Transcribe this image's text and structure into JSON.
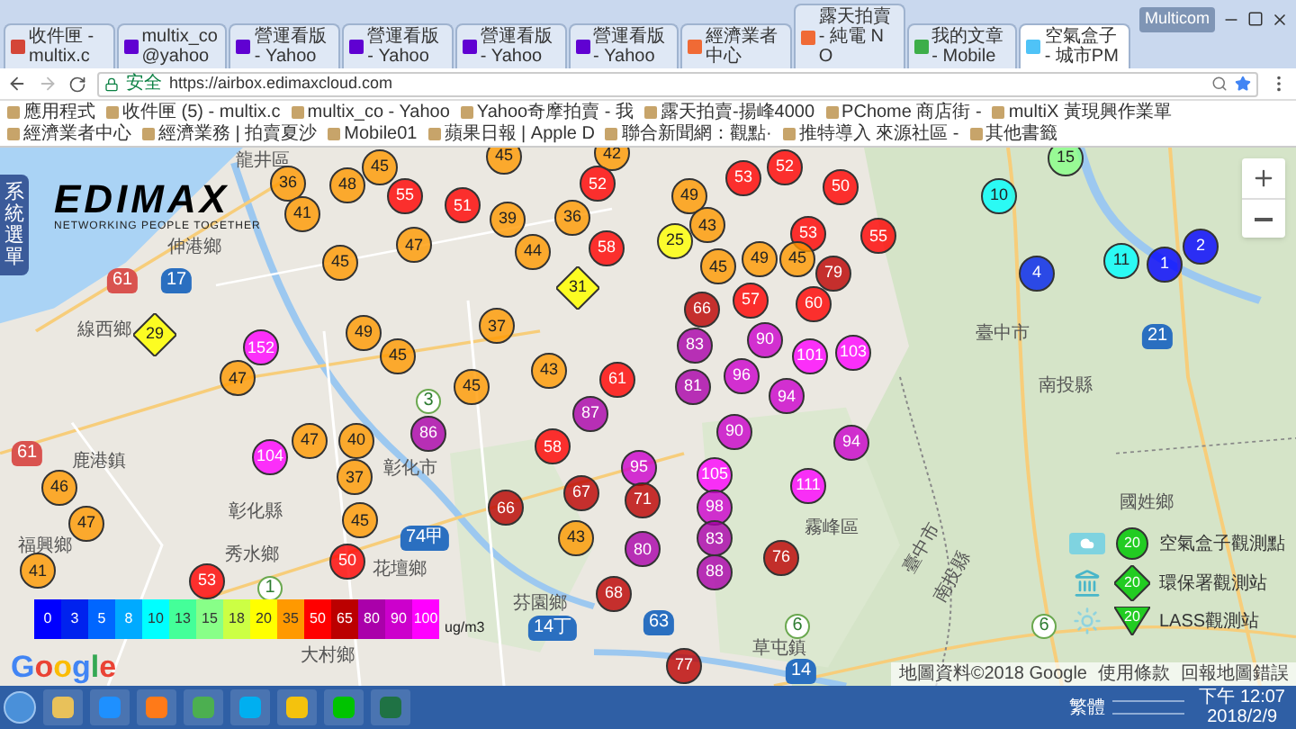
{
  "tabs": [
    {
      "title": "收件匣 - multix.c",
      "kind": "gmail",
      "selected": false
    },
    {
      "title": "multix_co@yahoo",
      "kind": "yahoo",
      "selected": false
    },
    {
      "title": "營運看版 - Yahoo",
      "kind": "yahoo",
      "selected": false
    },
    {
      "title": "營運看版 - Yahoo",
      "kind": "yahoo",
      "selected": false
    },
    {
      "title": "營運看版 - Yahoo",
      "kind": "yahoo",
      "selected": false
    },
    {
      "title": "營運看版 - Yahoo",
      "kind": "yahoo",
      "selected": false
    },
    {
      "title": "經濟業者中心",
      "kind": "shop",
      "selected": false
    },
    {
      "title": "露天拍賣 - 純電 NO",
      "kind": "shop",
      "selected": false
    },
    {
      "title": "我的文章 - Mobile",
      "kind": "forum",
      "selected": false
    },
    {
      "title": "空氣盒子 - 城市PM",
      "kind": "air",
      "selected": true
    }
  ],
  "window_user": "Multicom",
  "address": {
    "security": "安全",
    "url": "https://airbox.edimaxcloud.com"
  },
  "bookmarks": [
    "應用程式",
    "收件匣 (5) - multix.c",
    "multix_co - Yahoo",
    "Yahoo奇摩拍賣 - 我",
    "露天拍賣-揚峰4000",
    "PChome 商店街 -",
    "multiX 黃現興作業單",
    "經濟業者中心",
    "經濟業務 | 拍賣夏沙",
    "Mobile01",
    "蘋果日報 | Apple D",
    "聯合新聞網：觀點·",
    "推特導入 來源社區 -",
    "其他書籤"
  ],
  "side_menu": "系統選單",
  "logo": {
    "name": "EDIMAX",
    "tagline": "NETWORKING PEOPLE TOGETHER"
  },
  "map": {
    "places": [
      "龍井區",
      "伸港鄉",
      "線西鄉",
      "鹿港鎮",
      "福興鄉",
      "彰化縣",
      "秀水鄉",
      "彰化市",
      "花壇鄉",
      "芬園鄉",
      "大村鄉",
      "草屯鎮",
      "霧峰區",
      "國姓鄉",
      "臺中市",
      "南投縣",
      "臺中市",
      "南投縣"
    ],
    "roads": [
      {
        "number": "61",
        "kind": "expressway"
      },
      {
        "number": "17",
        "kind": "provincial"
      },
      {
        "number": "61",
        "kind": "expressway"
      },
      {
        "number": "74甲",
        "kind": "provincial"
      },
      {
        "number": "14丁",
        "kind": "provincial"
      },
      {
        "number": "63",
        "kind": "provincial"
      },
      {
        "number": "14",
        "kind": "provincial"
      },
      {
        "number": "21",
        "kind": "provincial"
      },
      {
        "number": "6",
        "kind": "freeway"
      },
      {
        "number": "6",
        "kind": "freeway"
      },
      {
        "number": "1",
        "kind": "freeway"
      },
      {
        "number": "3",
        "kind": "freeway"
      }
    ],
    "markers": [
      {
        "value": "36",
        "kind": "circle"
      },
      {
        "value": "41",
        "kind": "circle"
      },
      {
        "value": "48",
        "kind": "circle"
      },
      {
        "value": "45",
        "kind": "circle"
      },
      {
        "value": "55",
        "kind": "circle"
      },
      {
        "value": "51",
        "kind": "circle"
      },
      {
        "value": "47",
        "kind": "circle"
      },
      {
        "value": "45",
        "kind": "circle"
      },
      {
        "value": "39",
        "kind": "circle"
      },
      {
        "value": "44",
        "kind": "circle"
      },
      {
        "value": "36",
        "kind": "circle"
      },
      {
        "value": "42",
        "kind": "circle"
      },
      {
        "value": "58",
        "kind": "circle"
      },
      {
        "value": "52",
        "kind": "circle"
      },
      {
        "value": "25",
        "kind": "circle"
      },
      {
        "value": "31",
        "kind": "diamond"
      },
      {
        "value": "45",
        "kind": "circle"
      },
      {
        "value": "49",
        "kind": "circle"
      },
      {
        "value": "45",
        "kind": "circle"
      },
      {
        "value": "37",
        "kind": "circle"
      },
      {
        "value": "43",
        "kind": "circle"
      },
      {
        "value": "61",
        "kind": "circle"
      },
      {
        "value": "152",
        "kind": "circle"
      },
      {
        "value": "47",
        "kind": "circle"
      },
      {
        "value": "29",
        "kind": "diamond"
      },
      {
        "value": "45",
        "kind": "circle"
      },
      {
        "value": "87",
        "kind": "circle"
      },
      {
        "value": "52",
        "kind": "circle"
      },
      {
        "value": "53",
        "kind": "circle"
      },
      {
        "value": "49",
        "kind": "circle"
      },
      {
        "value": "50",
        "kind": "circle"
      },
      {
        "value": "43",
        "kind": "circle"
      },
      {
        "value": "53",
        "kind": "circle"
      },
      {
        "value": "55",
        "kind": "circle"
      },
      {
        "value": "45",
        "kind": "circle"
      },
      {
        "value": "49",
        "kind": "circle"
      },
      {
        "value": "45",
        "kind": "circle"
      },
      {
        "value": "79",
        "kind": "circle"
      },
      {
        "value": "57",
        "kind": "circle"
      },
      {
        "value": "60",
        "kind": "circle"
      },
      {
        "value": "66",
        "kind": "circle"
      },
      {
        "value": "83",
        "kind": "circle"
      },
      {
        "value": "90",
        "kind": "circle"
      },
      {
        "value": "101",
        "kind": "circle"
      },
      {
        "value": "103",
        "kind": "circle"
      },
      {
        "value": "96",
        "kind": "circle"
      },
      {
        "value": "81",
        "kind": "circle"
      },
      {
        "value": "94",
        "kind": "circle"
      },
      {
        "value": "10",
        "kind": "circle"
      },
      {
        "value": "15",
        "kind": "circle"
      },
      {
        "value": "4",
        "kind": "circle"
      },
      {
        "value": "11",
        "kind": "circle"
      },
      {
        "value": "1",
        "kind": "circle"
      },
      {
        "value": "2",
        "kind": "circle"
      },
      {
        "value": "86",
        "kind": "circle"
      },
      {
        "value": "47",
        "kind": "circle"
      },
      {
        "value": "40",
        "kind": "circle"
      },
      {
        "value": "104",
        "kind": "circle"
      },
      {
        "value": "37",
        "kind": "circle"
      },
      {
        "value": "46",
        "kind": "circle"
      },
      {
        "value": "47",
        "kind": "circle"
      },
      {
        "value": "41",
        "kind": "circle"
      },
      {
        "value": "53",
        "kind": "circle"
      },
      {
        "value": "45",
        "kind": "circle"
      },
      {
        "value": "50",
        "kind": "circle"
      },
      {
        "value": "58",
        "kind": "circle"
      },
      {
        "value": "67",
        "kind": "circle"
      },
      {
        "value": "66",
        "kind": "circle"
      },
      {
        "value": "43",
        "kind": "circle"
      },
      {
        "value": "68",
        "kind": "circle"
      },
      {
        "value": "95",
        "kind": "circle"
      },
      {
        "value": "71",
        "kind": "circle"
      },
      {
        "value": "80",
        "kind": "circle"
      },
      {
        "value": "90",
        "kind": "circle"
      },
      {
        "value": "94",
        "kind": "circle"
      },
      {
        "value": "105",
        "kind": "circle"
      },
      {
        "value": "111",
        "kind": "circle"
      },
      {
        "value": "98",
        "kind": "circle"
      },
      {
        "value": "83",
        "kind": "circle"
      },
      {
        "value": "76",
        "kind": "circle"
      },
      {
        "value": "88",
        "kind": "circle"
      },
      {
        "value": "77",
        "kind": "circle"
      }
    ],
    "legend": {
      "items": [
        {
          "label": "0",
          "color": "#0000ff"
        },
        {
          "label": "3",
          "color": "#0022ee"
        },
        {
          "label": "5",
          "color": "#0066ff"
        },
        {
          "label": "8",
          "color": "#00aaff"
        },
        {
          "label": "10",
          "color": "#00ffff"
        },
        {
          "label": "13",
          "color": "#44ff99"
        },
        {
          "label": "15",
          "color": "#88ff88"
        },
        {
          "label": "18",
          "color": "#ccff44"
        },
        {
          "label": "20",
          "color": "#ffff00"
        },
        {
          "label": "35",
          "color": "#ff9900"
        },
        {
          "label": "50",
          "color": "#ff0000"
        },
        {
          "label": "65",
          "color": "#bb0000"
        },
        {
          "label": "80",
          "color": "#aa00aa"
        },
        {
          "label": "90",
          "color": "#cc00cc"
        },
        {
          "label": "100",
          "color": "#ff00ff"
        }
      ],
      "unit": "ug/m3"
    },
    "key": [
      {
        "kind": "airbox",
        "badge": "20",
        "label": "空氣盒子觀測點"
      },
      {
        "kind": "epa",
        "badge": "20",
        "label": "環保署觀測站"
      },
      {
        "kind": "lass",
        "badge": "20",
        "label": "LASS觀測站"
      }
    ],
    "attribution": [
      "地圖資料©2018 Google",
      "使用條款",
      "回報地圖錯誤"
    ],
    "google": "Google"
  },
  "taskbar": {
    "language": "繁體",
    "time": "下午 12:07",
    "date": "2018/2/9"
  }
}
